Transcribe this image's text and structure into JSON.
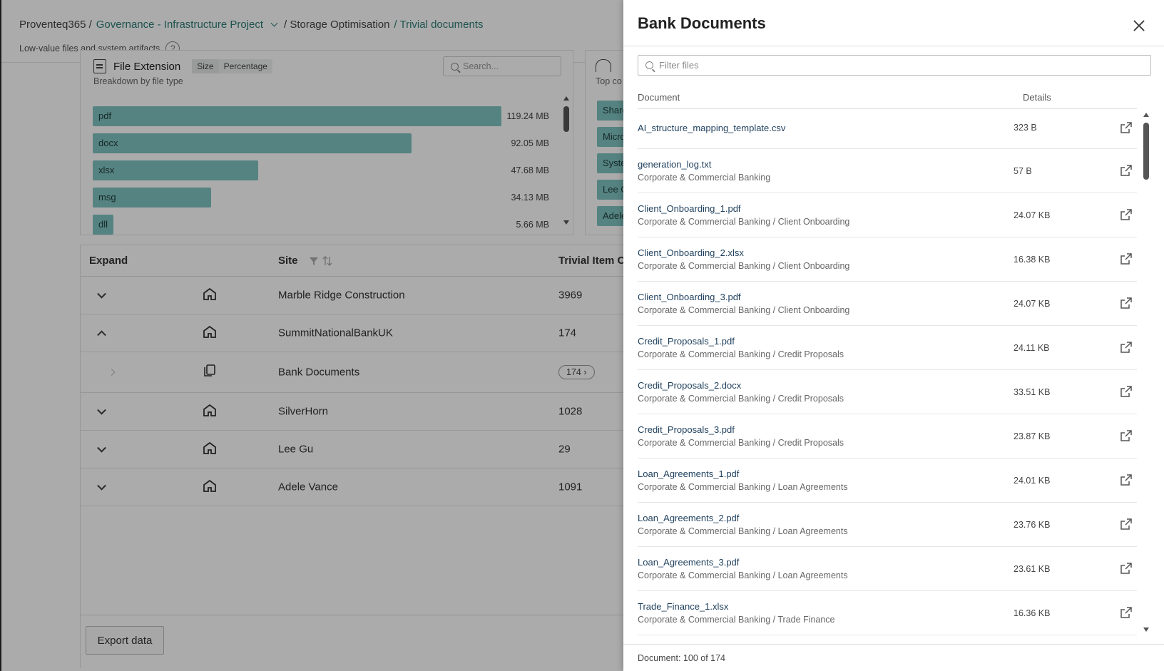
{
  "breadcrumb": {
    "root": "Proventeq365 /",
    "project": "Governance - Infrastructure Project",
    "section": "/ Storage Optimisation",
    "current": "/ Trivial documents"
  },
  "subtitle": "Low-value files and system artifacts",
  "file_extension": {
    "title": "File Extension",
    "toggle_size": "Size",
    "toggle_percentage": "Percentage",
    "subtitle": "Breakdown by file type",
    "search_placeholder": "Search...",
    "rows": [
      {
        "label": "pdf",
        "value": "119.24 MB",
        "fraction": 1.0
      },
      {
        "label": "docx",
        "value": "92.05 MB",
        "fraction": 0.78
      },
      {
        "label": "xlsx",
        "value": "47.68 MB",
        "fraction": 0.405
      },
      {
        "label": "msg",
        "value": "34.13 MB",
        "fraction": 0.29
      },
      {
        "label": "dll",
        "value": "5.66 MB",
        "fraction": 0.05
      }
    ]
  },
  "top_contributors": {
    "subtitle": "Top co",
    "pills": [
      "Share",
      "Micro",
      "Syste",
      "Lee G",
      "Adele"
    ]
  },
  "table": {
    "headers": {
      "expand": "Expand",
      "site": "Site",
      "trivial": "Trivial Item C"
    },
    "rows": [
      {
        "site": "Marble Ridge Construction",
        "count": "3969"
      },
      {
        "site": "SummitNationalBankUK",
        "count": "174"
      },
      {
        "site": "Bank Documents",
        "count": "174"
      },
      {
        "site": "SilverHorn",
        "count": "1028"
      },
      {
        "site": "Lee Gu",
        "count": "29"
      },
      {
        "site": "Adele Vance",
        "count": "1091"
      }
    ],
    "export_label": "Export data"
  },
  "panel": {
    "title": "Bank Documents",
    "filter_placeholder": "Filter files",
    "col_document": "Document",
    "col_details": "Details",
    "documents": [
      {
        "name": "AI_structure_mapping_template.csv",
        "path": "",
        "size": "323 B"
      },
      {
        "name": "generation_log.txt",
        "path": "Corporate & Commercial Banking",
        "size": "57 B"
      },
      {
        "name": "Client_Onboarding_1.pdf",
        "path": "Corporate & Commercial Banking / Client Onboarding",
        "size": "24.07 KB"
      },
      {
        "name": "Client_Onboarding_2.xlsx",
        "path": "Corporate & Commercial Banking / Client Onboarding",
        "size": "16.38 KB"
      },
      {
        "name": "Client_Onboarding_3.pdf",
        "path": "Corporate & Commercial Banking / Client Onboarding",
        "size": "24.07 KB"
      },
      {
        "name": "Credit_Proposals_1.pdf",
        "path": "Corporate & Commercial Banking / Credit Proposals",
        "size": "24.11 KB"
      },
      {
        "name": "Credit_Proposals_2.docx",
        "path": "Corporate & Commercial Banking / Credit Proposals",
        "size": "33.51 KB"
      },
      {
        "name": "Credit_Proposals_3.pdf",
        "path": "Corporate & Commercial Banking / Credit Proposals",
        "size": "23.87 KB"
      },
      {
        "name": "Loan_Agreements_1.pdf",
        "path": "Corporate & Commercial Banking / Loan Agreements",
        "size": "24.01 KB"
      },
      {
        "name": "Loan_Agreements_2.pdf",
        "path": "Corporate & Commercial Banking / Loan Agreements",
        "size": "23.76 KB"
      },
      {
        "name": "Loan_Agreements_3.pdf",
        "path": "Corporate & Commercial Banking / Loan Agreements",
        "size": "23.61 KB"
      },
      {
        "name": "Trade_Finance_1.xlsx",
        "path": "Corporate & Commercial Banking / Trade Finance",
        "size": "16.36 KB"
      }
    ],
    "footer": "Document: 100 of 174"
  }
}
